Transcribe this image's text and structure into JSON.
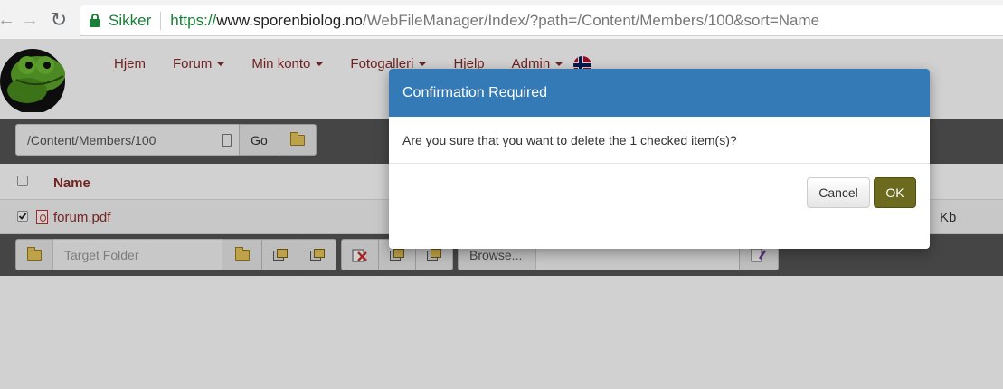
{
  "browser": {
    "secure_label": "Sikker",
    "url_proto": "https://",
    "url_host": "www.sporenbiolog.no",
    "url_path": "/WebFileManager/Index/?path=/Content/Members/100&sort=Name",
    "back_icon": "arrow-left-icon",
    "forward_icon": "arrow-right-icon",
    "reload_icon": "reload-icon"
  },
  "nav": {
    "items": [
      {
        "label": "Hjem",
        "dropdown": false
      },
      {
        "label": "Forum",
        "dropdown": true
      },
      {
        "label": "Min konto",
        "dropdown": true
      },
      {
        "label": "Fotogalleri",
        "dropdown": true
      },
      {
        "label": "Hjelp",
        "dropdown": false
      },
      {
        "label": "Admin",
        "dropdown": true
      }
    ],
    "language_flag": "norway-flag-icon"
  },
  "path_bar": {
    "path_value": "/Content/Members/100",
    "go_label": "Go"
  },
  "table": {
    "header_name": "Name",
    "rows": [
      {
        "name": "forum.pdf",
        "size_unit": "Kb",
        "checked": true,
        "icon": "pdf-icon"
      }
    ]
  },
  "actions": {
    "target_placeholder": "Target Folder",
    "browse_label": "Browse..."
  },
  "modal": {
    "title": "Confirmation Required",
    "message": "Are you sure that you want to delete the 1 checked item(s)?",
    "cancel_label": "Cancel",
    "ok_label": "OK"
  },
  "colors": {
    "modal_header": "#337ab7",
    "ok_button": "#6b6a1f",
    "link": "#8b2a2a",
    "secure_green": "#188038"
  }
}
